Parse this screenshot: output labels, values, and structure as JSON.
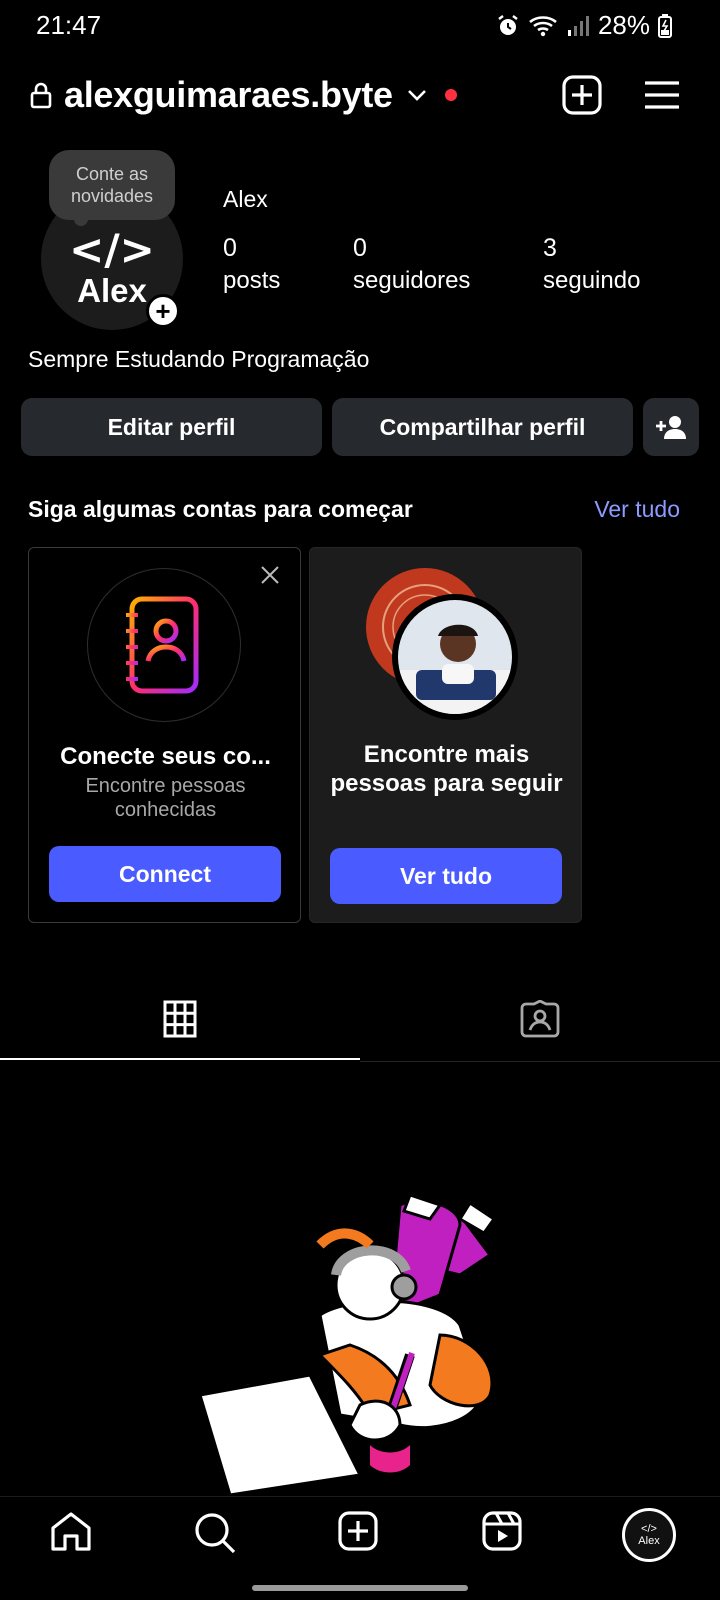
{
  "status_bar": {
    "time": "21:47",
    "battery": "28%"
  },
  "header": {
    "username": "alexguimaraes.byte"
  },
  "profile": {
    "note": "Conte as novidades",
    "avatar_code": "</>",
    "avatar_name": "Alex",
    "name": "Alex",
    "stats": [
      {
        "value": "0",
        "label": "posts"
      },
      {
        "value": "0",
        "label": "seguidores"
      },
      {
        "value": "3",
        "label": "seguindo"
      }
    ],
    "bio": "Sempre Estudando Programação"
  },
  "actions": {
    "edit": "Editar perfil",
    "share": "Compartilhar perfil"
  },
  "suggestions": {
    "title": "Siga algumas contas para começar",
    "see_all": "Ver tudo",
    "cards": [
      {
        "title": "Conecte seus co...",
        "subtitle": "Encontre pessoas conhecidas",
        "button": "Connect"
      },
      {
        "title": "Encontre mais pessoas para seguir",
        "button": "Ver tudo"
      }
    ]
  },
  "nav_avatar": {
    "code": "</>",
    "name": "Alex"
  },
  "colors": {
    "accent": "#4a5cff",
    "link": "#8c9bff",
    "notification": "#ff3040",
    "button_bg": "#262a2e"
  },
  "icons": [
    "lock-icon",
    "chevron-down-icon",
    "new-post-icon",
    "menu-icon",
    "add-person-icon",
    "contacts-book-icon",
    "close-icon",
    "grid-icon",
    "tagged-icon",
    "home-icon",
    "search-icon",
    "create-icon",
    "reels-icon"
  ]
}
